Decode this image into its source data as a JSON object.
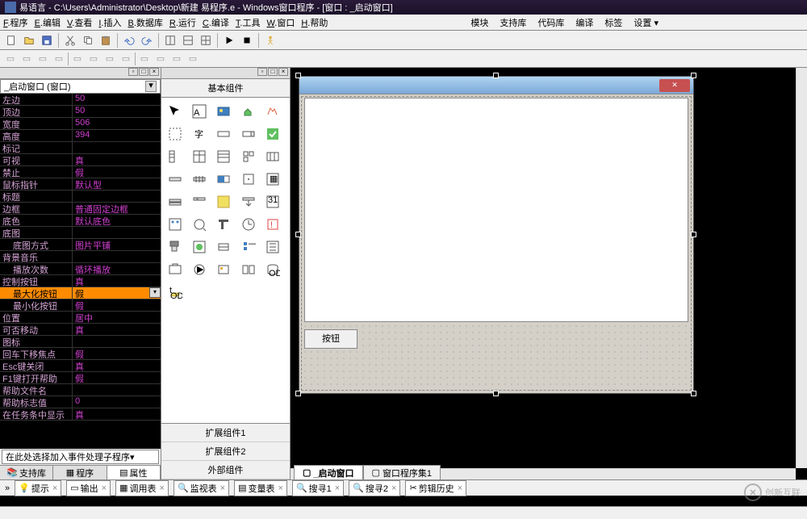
{
  "titlebar": "易语言 - C:\\Users\\Administrator\\Desktop\\新建 易程序.e - Windows窗口程序 - [窗口 : _启动窗口]",
  "menu": {
    "left": [
      "F.程序",
      "E.编辑",
      "V.查看",
      "I.插入",
      "B.数据库",
      "R.运行",
      "C.编译",
      "T.工具",
      "W.窗口",
      "H.帮助"
    ],
    "right": [
      "模块",
      "支持库",
      "代码库",
      "编译",
      "标签",
      "设置 ▾"
    ]
  },
  "property_panel": {
    "dropdown": "_启动窗口 (窗口)",
    "rows": [
      {
        "name": "左边",
        "val": "50"
      },
      {
        "name": "顶边",
        "val": "50"
      },
      {
        "name": "宽度",
        "val": "506"
      },
      {
        "name": "高度",
        "val": "394"
      },
      {
        "name": "标记",
        "val": ""
      },
      {
        "name": "可视",
        "val": "真"
      },
      {
        "name": "禁止",
        "val": "假"
      },
      {
        "name": "鼠标指针",
        "val": "默认型"
      },
      {
        "name": "标题",
        "val": ""
      },
      {
        "name": "边框",
        "val": "普通固定边框"
      },
      {
        "name": "底色",
        "val": "默认底色"
      },
      {
        "name": "底图",
        "val": ""
      },
      {
        "name": "底图方式",
        "val": "图片平铺",
        "indent": true
      },
      {
        "name": "背景音乐",
        "val": ""
      },
      {
        "name": "播放次数",
        "val": "循环播放",
        "indent": true
      },
      {
        "name": "控制按钮",
        "val": "真"
      },
      {
        "name": "最大化按钮",
        "val": "假",
        "selected": true,
        "indent": true
      },
      {
        "name": "最小化按钮",
        "val": "假",
        "indent": true
      },
      {
        "name": "位置",
        "val": "居中"
      },
      {
        "name": "可否移动",
        "val": "真"
      },
      {
        "name": "图标",
        "val": ""
      },
      {
        "name": "回车下移焦点",
        "val": "假"
      },
      {
        "name": "Esc键关闭",
        "val": "真"
      },
      {
        "name": "F1键打开帮助",
        "val": "假"
      },
      {
        "name": "帮助文件名",
        "val": ""
      },
      {
        "name": "帮助标志值",
        "val": "0"
      },
      {
        "name": "在任务条中显示",
        "val": "真"
      }
    ],
    "event_dropdown": "在此处选择加入事件处理子程序",
    "tabs": [
      "支持库",
      "程序",
      "属性"
    ]
  },
  "component_panel": {
    "title": "基本组件",
    "ext": [
      "扩展组件1",
      "扩展组件2",
      "外部组件"
    ]
  },
  "design": {
    "tabs": [
      "_启动窗口",
      "窗口程序集1"
    ],
    "button_label": "按钮"
  },
  "bottom": [
    "提示",
    "输出",
    "调用表",
    "监视表",
    "变量表",
    "搜寻1",
    "搜寻2",
    "剪辑历史"
  ],
  "watermark": "创新互联"
}
